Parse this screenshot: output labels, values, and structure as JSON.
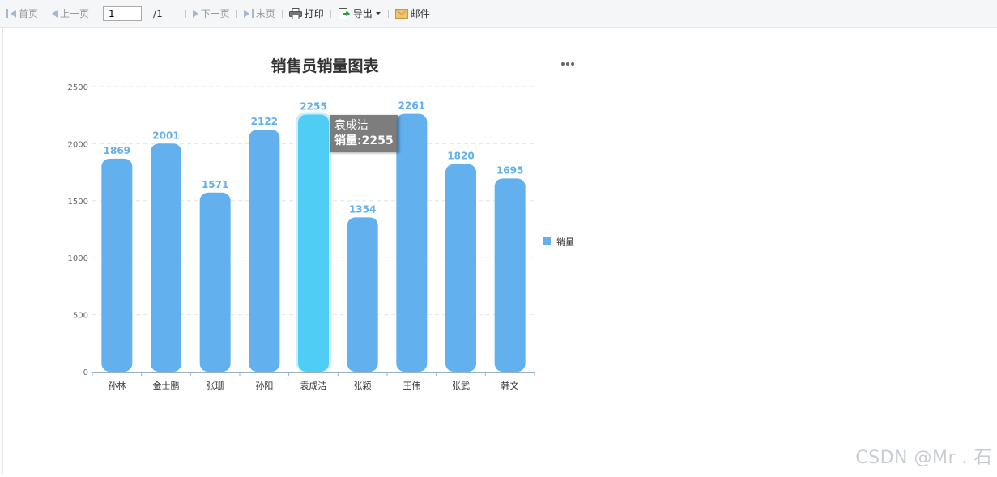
{
  "toolbar": {
    "first_label": "首页",
    "prev_label": "上一页",
    "page_value": "1",
    "page_total": "/1",
    "next_label": "下一页",
    "last_label": "末页",
    "print_label": "打印",
    "export_label": "导出",
    "mail_label": "邮件"
  },
  "tooltip": {
    "name": "袁成洁",
    "value_line": "销量:2255"
  },
  "watermark": "CSDN @Mr . 石",
  "colors": {
    "bar": "#63b0ee",
    "bar_highlight": "#4fcdf4",
    "label": "#63b0ee",
    "axis_text": "#666666",
    "grid": "#e6e6e6"
  },
  "chart_data": {
    "type": "bar",
    "title": "销售员销量图表",
    "categories": [
      "孙林",
      "金士鹏",
      "张珊",
      "孙阳",
      "袁成洁",
      "张颖",
      "王伟",
      "张武",
      "韩文"
    ],
    "series": [
      {
        "name": "销量",
        "values": [
          1869,
          2001,
          1571,
          2122,
          2255,
          1354,
          2261,
          1820,
          1695
        ]
      }
    ],
    "yticks": [
      0,
      500,
      1000,
      1500,
      2000,
      2500
    ],
    "ylim": [
      0,
      2500
    ],
    "highlighted_index": 4,
    "legend_position": "right",
    "grid": true
  }
}
